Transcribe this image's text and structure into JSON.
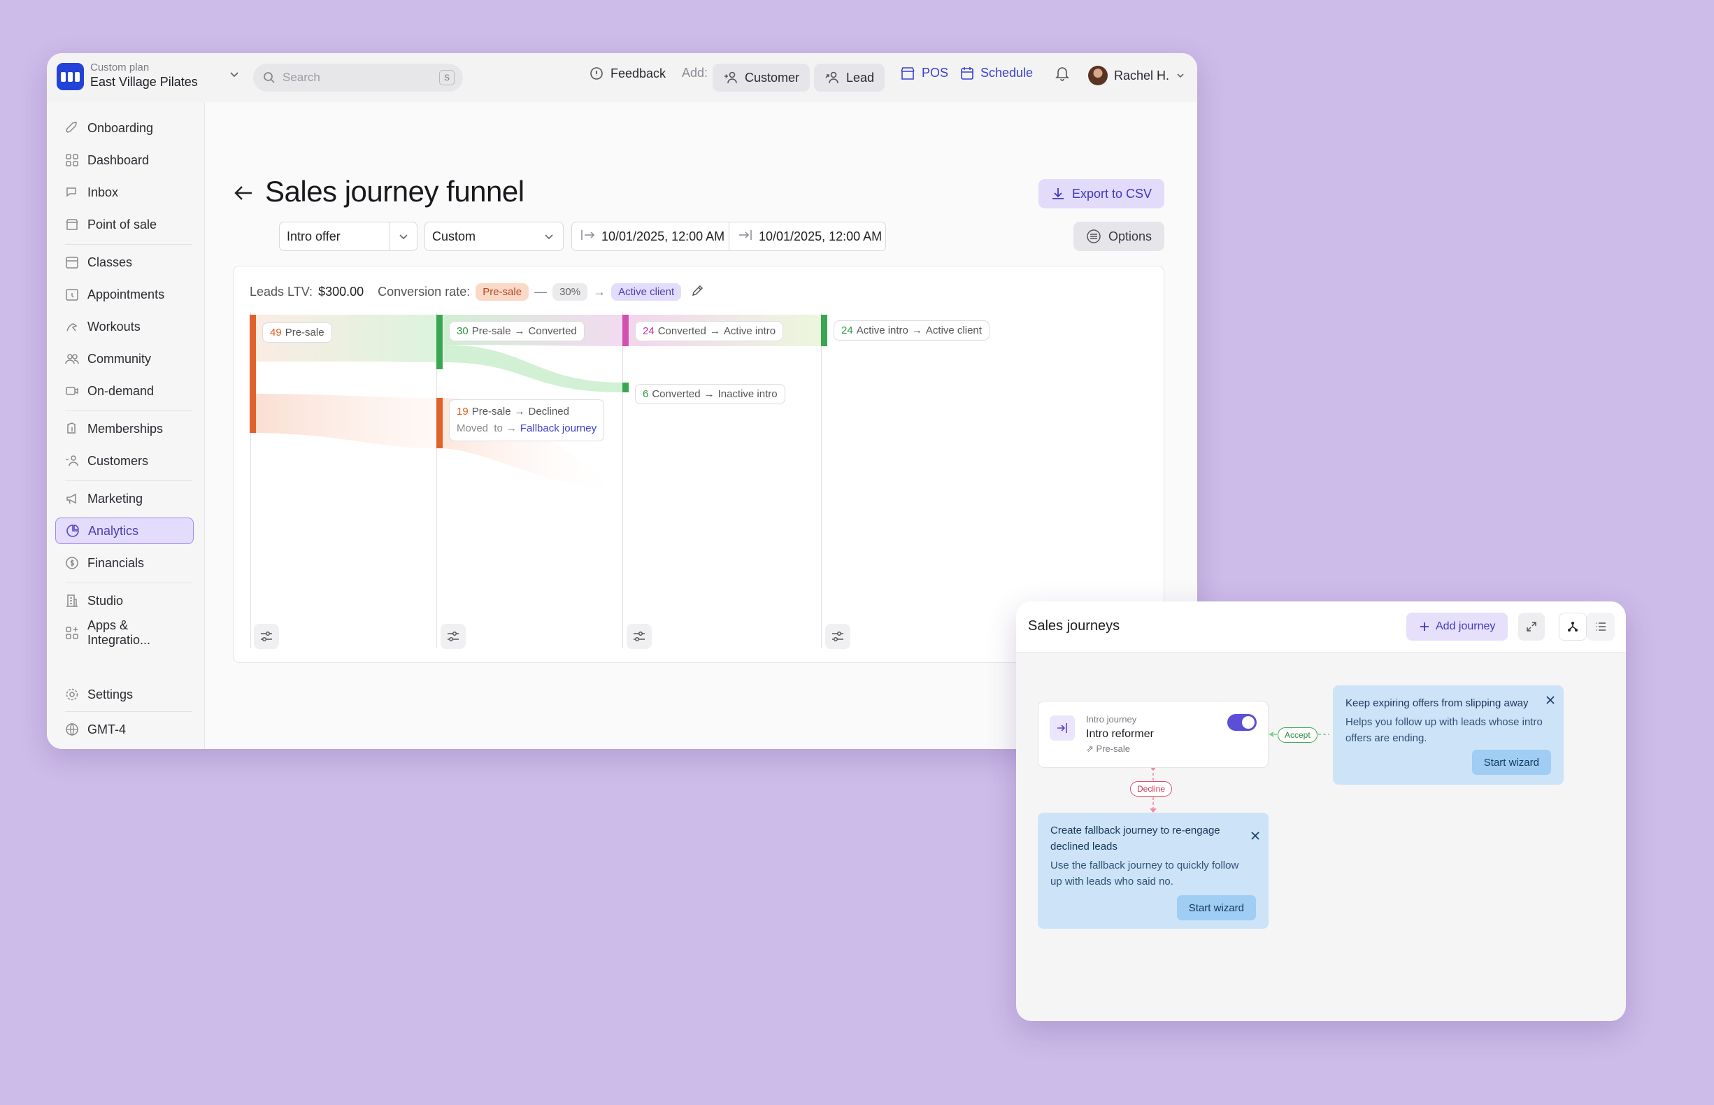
{
  "topbar": {
    "plan_label": "Custom plan",
    "studio_name": "East Village Pilates",
    "search_placeholder": "Search",
    "search_shortcut": "S",
    "feedback": "Feedback",
    "add_label": "Add:",
    "add_customer": "Customer",
    "add_lead": "Lead",
    "pos": "POS",
    "schedule": "Schedule",
    "user_name": "Rachel H."
  },
  "sidebar": {
    "items": [
      {
        "label": "Onboarding",
        "icon": "rocket-icon"
      },
      {
        "label": "Dashboard",
        "icon": "grid-icon"
      },
      {
        "label": "Inbox",
        "icon": "chat-icon"
      },
      {
        "label": "Point of sale",
        "icon": "store-icon"
      },
      {
        "label": "Classes",
        "icon": "calendar-icon"
      },
      {
        "label": "Appointments",
        "icon": "clock-calendar-icon"
      },
      {
        "label": "Workouts",
        "icon": "workout-icon"
      },
      {
        "label": "Community",
        "icon": "people-icon"
      },
      {
        "label": "On-demand",
        "icon": "video-icon"
      },
      {
        "label": "Memberships",
        "icon": "membership-icon"
      },
      {
        "label": "Customers",
        "icon": "customers-icon"
      },
      {
        "label": "Marketing",
        "icon": "megaphone-icon"
      },
      {
        "label": "Analytics",
        "icon": "pie-chart-icon"
      },
      {
        "label": "Financials",
        "icon": "dollar-icon"
      },
      {
        "label": "Studio",
        "icon": "building-icon"
      },
      {
        "label": "Apps & Integratio...",
        "icon": "apps-icon"
      },
      {
        "label": "Settings",
        "icon": "gear-icon"
      },
      {
        "label": "GMT-4",
        "icon": "globe-icon"
      }
    ],
    "active": "Analytics"
  },
  "page": {
    "title": "Sales journey funnel",
    "export_label": "Export to CSV",
    "filter_offer": "Intro offer",
    "filter_range": "Custom",
    "date_start": "10/01/2025, 12:00 AM",
    "date_end": "10/01/2025, 12:00 AM",
    "options_label": "Options"
  },
  "funnel": {
    "ltv_label": "Leads LTV:",
    "ltv_value": "$300.00",
    "conversion_label": "Conversion rate:",
    "conv_from": "Pre-sale",
    "conv_pct": "30%",
    "conv_to": "Active client",
    "nodes": [
      {
        "count": "49",
        "from": "Pre-sale"
      },
      {
        "count": "30",
        "from": "Pre-sale",
        "to": "Converted"
      },
      {
        "count": "19",
        "from": "Pre-sale",
        "to": "Declined",
        "moved_label": "Moved  to",
        "moved_target": "Fallback journey"
      },
      {
        "count": "24",
        "from": "Converted",
        "to": "Active intro"
      },
      {
        "count": "6",
        "from": "Converted",
        "to": "Inactive intro"
      },
      {
        "count": "24",
        "from": "Active intro",
        "to": "Active client"
      }
    ],
    "colors": {
      "orange": "#e0622a",
      "green": "#3aa653",
      "pink": "#d34fb0"
    }
  },
  "journeys": {
    "title": "Sales journeys",
    "add_label": "Add journey",
    "card": {
      "kicker": "Intro journey",
      "name": "Intro reformer",
      "stage": "Pre-sale",
      "enabled": true
    },
    "accept_label": "Accept",
    "decline_label": "Decline",
    "tip_expiring": {
      "title": "Keep expiring offers from slipping away",
      "body": "Helps you follow up with leads whose intro offers are ending.",
      "button": "Start wizard"
    },
    "tip_fallback": {
      "title": "Create fallback journey to re-engage declined leads",
      "body": "Use the fallback journey to quickly follow up with leads who said no.",
      "button": "Start wizard"
    }
  }
}
